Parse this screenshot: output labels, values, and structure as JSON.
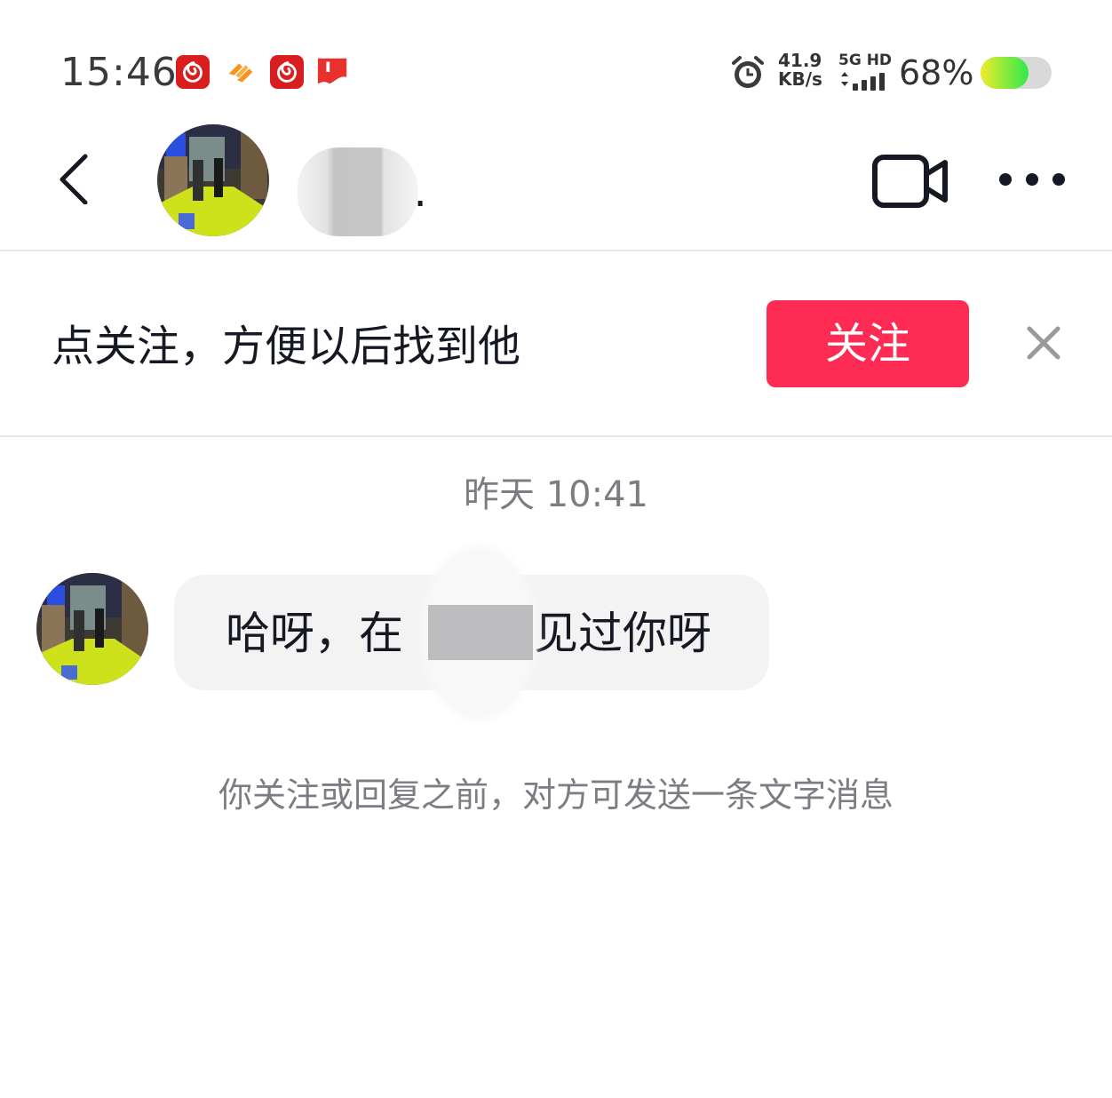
{
  "status_bar": {
    "time": "15:46",
    "net_speed_value": "41.9",
    "net_speed_unit": "KB/s",
    "network_type": "5G HD",
    "battery_percent": "68%",
    "battery_level": 0.68,
    "notification_icons": [
      "netease-music-icon",
      "orange-app-icon",
      "netease-music-icon",
      "red-flag-app-icon"
    ],
    "icons": [
      "alarm-icon",
      "signal-icon",
      "battery-icon"
    ]
  },
  "header": {
    "name_visible_fragment": "g.",
    "name_redacted": true,
    "icons": [
      "back-arrow-icon",
      "video-camera-icon",
      "more-dots-icon"
    ]
  },
  "follow_banner": {
    "prompt": "点关注，方便以后找到他",
    "button_label": "关注",
    "colors": {
      "button": "#fe2c55"
    }
  },
  "messages": {
    "timestamp": "昨天 10:41",
    "items": [
      {
        "sender": "other",
        "text_before_redaction": "哈呀，在",
        "text_after_redaction": "见过你呀",
        "redacted": true
      }
    ],
    "notice": "你关注或回复之前，对方可发送一条文字消息"
  }
}
